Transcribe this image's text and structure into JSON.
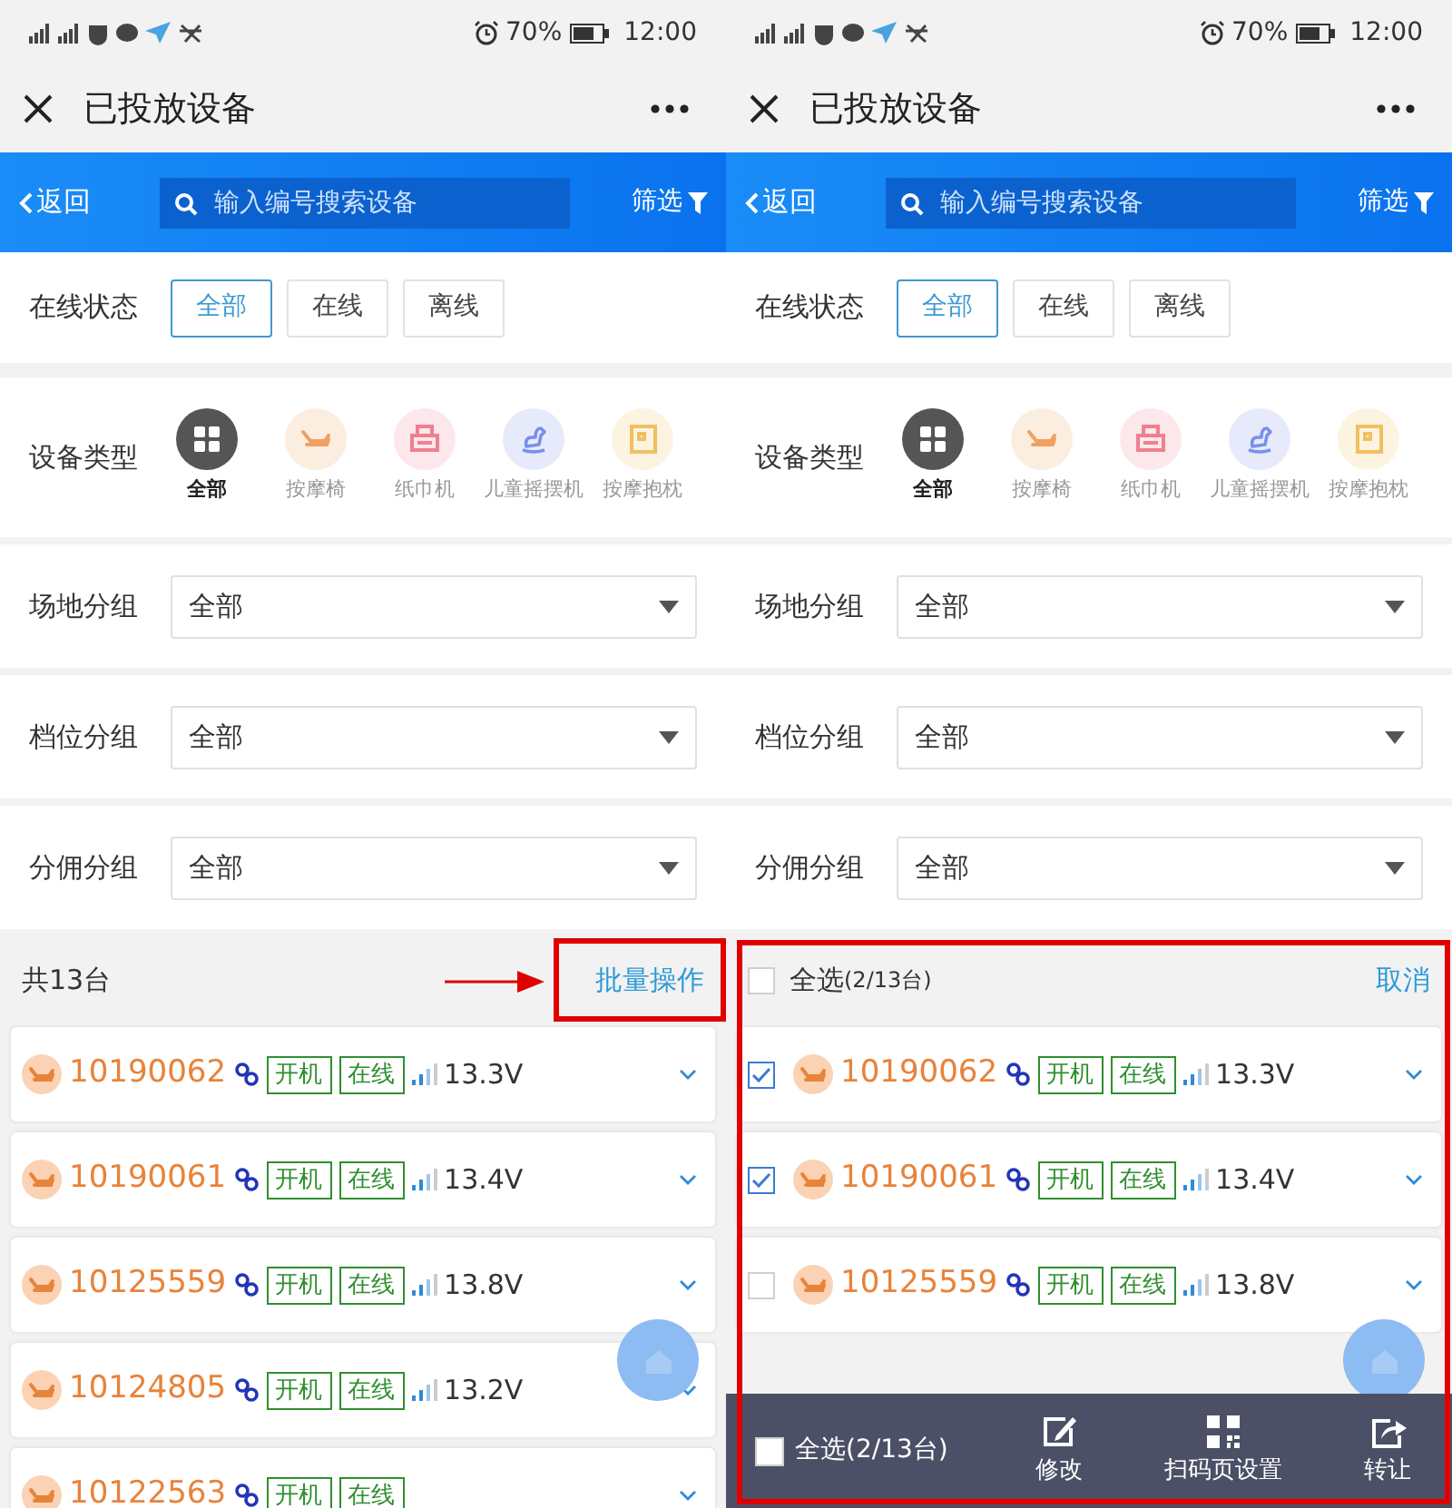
{
  "screens": [
    {
      "status_bar": {
        "battery": "70%",
        "time": "12:00"
      },
      "title": "已投放设备",
      "header": {
        "back": "返回",
        "search_placeholder": "输入编号搜索设备",
        "filter": "筛选"
      },
      "online_status": {
        "label": "在线状态",
        "options": [
          {
            "label": "全部",
            "selected": true
          },
          {
            "label": "在线",
            "selected": false
          },
          {
            "label": "离线",
            "selected": false
          }
        ]
      },
      "device_type": {
        "label": "设备类型",
        "items": [
          {
            "label": "全部",
            "kind": "grid",
            "color": "#555555",
            "selected": true
          },
          {
            "label": "按摩椅",
            "kind": "chair",
            "color": "#f0a060",
            "selected": false
          },
          {
            "label": "纸巾机",
            "kind": "printer",
            "color": "#ee8090",
            "selected": false
          },
          {
            "label": "儿童摇摆机",
            "kind": "horse",
            "color": "#7890e8",
            "selected": false
          },
          {
            "label": "按摩抱枕",
            "kind": "pillow",
            "color": "#f0c060",
            "selected": false
          }
        ]
      },
      "groups": [
        {
          "label": "场地分组",
          "value": "全部"
        },
        {
          "label": "档位分组",
          "value": "全部"
        },
        {
          "label": "分佣分组",
          "value": "全部"
        }
      ],
      "list_header": {
        "count": "共13台",
        "batch": "批量操作",
        "highlighted": true
      },
      "devices": [
        {
          "id": "10190062",
          "tags": [
            "开机",
            "在线"
          ],
          "voltage": "13.3V"
        },
        {
          "id": "10190061",
          "tags": [
            "开机",
            "在线"
          ],
          "voltage": "13.4V"
        },
        {
          "id": "10125559",
          "tags": [
            "开机",
            "在线"
          ],
          "voltage": "13.8V"
        },
        {
          "id": "10124805",
          "tags": [
            "开机",
            "在线"
          ],
          "voltage": "13.2V"
        },
        {
          "id": "10122563",
          "tags": [
            "开机",
            "在线"
          ]
        }
      ]
    },
    {
      "status_bar": {
        "battery": "70%",
        "time": "12:00"
      },
      "title": "已投放设备",
      "header": {
        "back": "返回",
        "search_placeholder": "输入编号搜索设备",
        "filter": "筛选"
      },
      "online_status": {
        "label": "在线状态",
        "options": [
          {
            "label": "全部",
            "selected": true
          },
          {
            "label": "在线",
            "selected": false
          },
          {
            "label": "离线",
            "selected": false
          }
        ]
      },
      "device_type": {
        "label": "设备类型",
        "items": [
          {
            "label": "全部",
            "kind": "grid",
            "color": "#555555",
            "selected": true
          },
          {
            "label": "按摩椅",
            "kind": "chair",
            "color": "#f0a060",
            "selected": false
          },
          {
            "label": "纸巾机",
            "kind": "printer",
            "color": "#ee8090",
            "selected": false
          },
          {
            "label": "儿童摇摆机",
            "kind": "horse",
            "color": "#7890e8",
            "selected": false
          },
          {
            "label": "按摩抱枕",
            "kind": "pillow",
            "color": "#f0c060",
            "selected": false
          }
        ]
      },
      "groups": [
        {
          "label": "场地分组",
          "value": "全部"
        },
        {
          "label": "档位分组",
          "value": "全部"
        },
        {
          "label": "分佣分组",
          "value": "全部"
        }
      ],
      "list_header": {
        "select_all": "全选",
        "selected_count": "(2/13台)",
        "checked": false,
        "cancel": "取消",
        "highlighted": true
      },
      "devices": [
        {
          "id": "10190062",
          "tags": [
            "开机",
            "在线"
          ],
          "voltage": "13.3V",
          "checked": true
        },
        {
          "id": "10190061",
          "tags": [
            "开机",
            "在线"
          ],
          "voltage": "13.4V",
          "checked": true
        },
        {
          "id": "10125559",
          "tags": [
            "开机",
            "在线"
          ],
          "voltage": "13.8V",
          "checked": false
        }
      ],
      "bottom_bar": {
        "select_all": "全选(2/13台)",
        "checked": false,
        "actions": [
          {
            "label": "修改",
            "kind": "edit"
          },
          {
            "label": "扫码页设置",
            "kind": "qr"
          },
          {
            "label": "转让",
            "kind": "share"
          }
        ]
      }
    }
  ]
}
